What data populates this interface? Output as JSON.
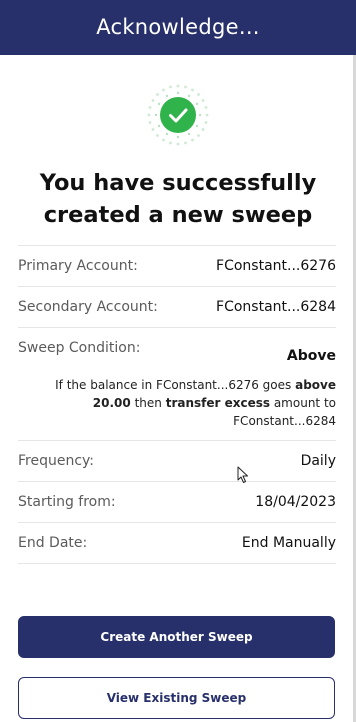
{
  "header": {
    "title": "Acknowledge..."
  },
  "status": {
    "icon": "success-check-icon",
    "color": "#2fb34a",
    "headline": "You have successfully created a new sweep"
  },
  "details": {
    "primary_account": {
      "label": "Primary Account:",
      "value": "FConstant...6276"
    },
    "secondary_account": {
      "label": "Secondary Account:",
      "value": "FConstant...6284"
    },
    "sweep_condition": {
      "label": "Sweep Condition:",
      "value": "Above",
      "desc_part1": "If the balance in FConstant...6276 goes ",
      "desc_bold1": "above 20.00",
      "desc_part2": " then ",
      "desc_bold2": "transfer excess",
      "desc_part3": " amount to FConstant...6284"
    },
    "frequency": {
      "label": "Frequency:",
      "value": "Daily"
    },
    "starting_from": {
      "label": "Starting from:",
      "value": "18/04/2023"
    },
    "end_date": {
      "label": "End Date:",
      "value": "End Manually"
    }
  },
  "actions": {
    "primary_label": "Create Another Sweep",
    "secondary_label": "View Existing Sweep"
  },
  "colors": {
    "brand": "#27306b",
    "success": "#2fb34a"
  }
}
